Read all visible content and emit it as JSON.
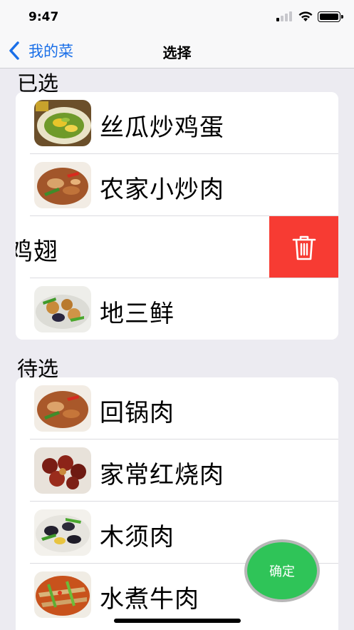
{
  "status": {
    "time": "9:47"
  },
  "nav": {
    "back_label": "我的菜",
    "title": "选择"
  },
  "selected": {
    "header": "已选",
    "items": [
      {
        "name": "丝瓜炒鸡蛋",
        "image": "stir-fried-loofah-egg"
      },
      {
        "name": "农家小炒肉",
        "image": "farmhouse-pork-stir-fry"
      },
      {
        "name": "可乐鸡翅",
        "image": "cola-chicken-wings"
      },
      {
        "name": "地三鲜",
        "image": "di-san-xian"
      }
    ],
    "delete_icon": "trash-icon"
  },
  "pending": {
    "header": "待选",
    "items": [
      {
        "name": "回锅肉",
        "image": "twice-cooked-pork"
      },
      {
        "name": "家常红烧肉",
        "image": "braised-pork"
      },
      {
        "name": "木须肉",
        "image": "moo-shu-pork"
      },
      {
        "name": "水煮牛肉",
        "image": "boiled-beef"
      }
    ]
  },
  "confirm_label": "确定",
  "colors": {
    "accent": "#1a6fe8",
    "delete": "#f73b33",
    "confirm": "#2fc458"
  }
}
